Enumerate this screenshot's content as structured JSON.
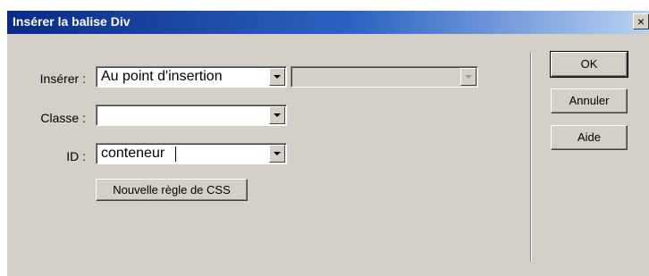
{
  "window": {
    "title": "Insérer la balise Div",
    "close_glyph": "×"
  },
  "form": {
    "inserer_label": "Insérer :",
    "inserer_value": "Au point d'insertion",
    "inserer_second_value": "",
    "classe_label": "Classe :",
    "classe_value": "",
    "id_label": "ID :",
    "id_value": "conteneur",
    "css_button_label": "Nouvelle règle de CSS"
  },
  "buttons": {
    "ok": "OK",
    "cancel": "Annuler",
    "help": "Aide"
  }
}
